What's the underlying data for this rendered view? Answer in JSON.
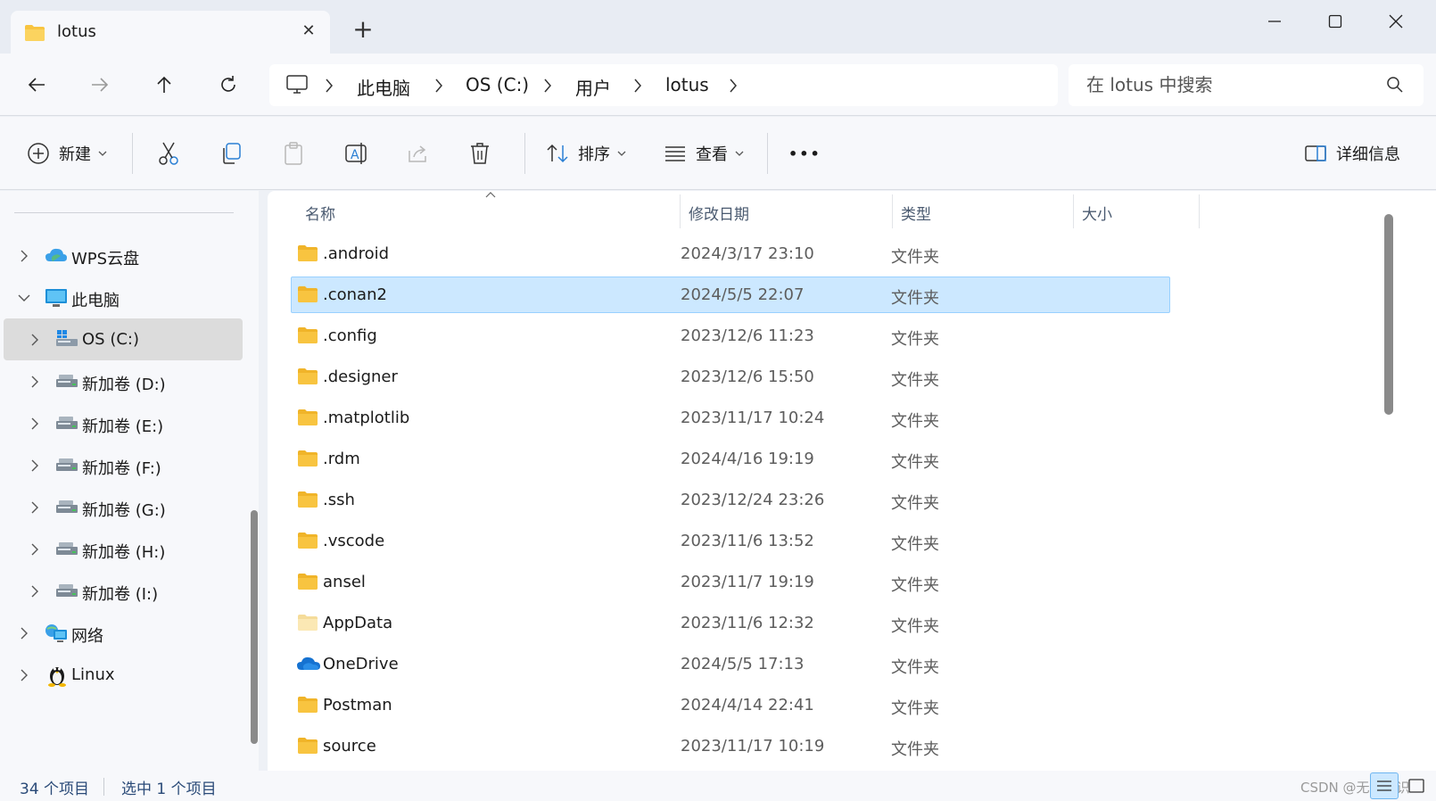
{
  "window": {
    "tab_title": "lotus",
    "new_tab_symbol": "+",
    "close_tab_symbol": "✕"
  },
  "breadcrumb": [
    "此电脑",
    "OS (C:)",
    "用户",
    "lotus"
  ],
  "search": {
    "placeholder": "在 lotus 中搜索"
  },
  "toolbar": {
    "new_label": "新建",
    "sort_label": "排序",
    "view_label": "查看",
    "more_label": "•••",
    "details_label": "详细信息"
  },
  "sidebar": {
    "items": [
      {
        "label": "WPS云盘",
        "icon": "cloud-icon"
      },
      {
        "label": "此电脑",
        "icon": "computer-icon"
      },
      {
        "label": "OS (C:)",
        "icon": "drive-icon"
      },
      {
        "label": "新加卷 (D:)",
        "icon": "drive-icon"
      },
      {
        "label": "新加卷 (E:)",
        "icon": "drive-icon"
      },
      {
        "label": "新加卷 (F:)",
        "icon": "drive-icon"
      },
      {
        "label": "新加卷 (G:)",
        "icon": "drive-icon"
      },
      {
        "label": "新加卷 (H:)",
        "icon": "drive-icon"
      },
      {
        "label": "新加卷 (I:)",
        "icon": "drive-icon"
      },
      {
        "label": "网络",
        "icon": "network-icon"
      },
      {
        "label": "Linux",
        "icon": "linux-icon"
      }
    ]
  },
  "columns": {
    "name": "名称",
    "date": "修改日期",
    "type": "类型",
    "size": "大小"
  },
  "files": [
    {
      "name": ".android",
      "date": "2024/3/17 23:10",
      "type": "文件夹",
      "icon": "folder-icon"
    },
    {
      "name": ".conan2",
      "date": "2024/5/5 22:07",
      "type": "文件夹",
      "icon": "folder-icon"
    },
    {
      "name": ".config",
      "date": "2023/12/6 11:23",
      "type": "文件夹",
      "icon": "folder-icon"
    },
    {
      "name": ".designer",
      "date": "2023/12/6 15:50",
      "type": "文件夹",
      "icon": "folder-icon"
    },
    {
      "name": ".matplotlib",
      "date": "2023/11/17 10:24",
      "type": "文件夹",
      "icon": "folder-icon"
    },
    {
      "name": ".rdm",
      "date": "2024/4/16 19:19",
      "type": "文件夹",
      "icon": "folder-icon"
    },
    {
      "name": ".ssh",
      "date": "2023/12/24 23:26",
      "type": "文件夹",
      "icon": "folder-icon"
    },
    {
      "name": ".vscode",
      "date": "2023/11/6 13:52",
      "type": "文件夹",
      "icon": "folder-icon"
    },
    {
      "name": "ansel",
      "date": "2023/11/7 19:19",
      "type": "文件夹",
      "icon": "folder-icon"
    },
    {
      "name": "AppData",
      "date": "2023/11/6 12:32",
      "type": "文件夹",
      "icon": "folder-hidden-icon"
    },
    {
      "name": "OneDrive",
      "date": "2024/5/5 17:13",
      "type": "文件夹",
      "icon": "onedrive-icon"
    },
    {
      "name": "Postman",
      "date": "2024/4/14 22:41",
      "type": "文件夹",
      "icon": "folder-icon"
    },
    {
      "name": "source",
      "date": "2023/11/17 10:19",
      "type": "文件夹",
      "icon": "folder-icon"
    }
  ],
  "status": {
    "item_count": "34 个项目",
    "selected_count": "选中 1 个项目",
    "watermark": "CSDN @无法辨识"
  },
  "colors": {
    "selection_bg": "#cce8ff",
    "selection_border": "#99d1ff",
    "folder_yellow": "#f8c440",
    "sidebar_selected": "#dcdcdc",
    "status_text": "#2a4a78"
  }
}
